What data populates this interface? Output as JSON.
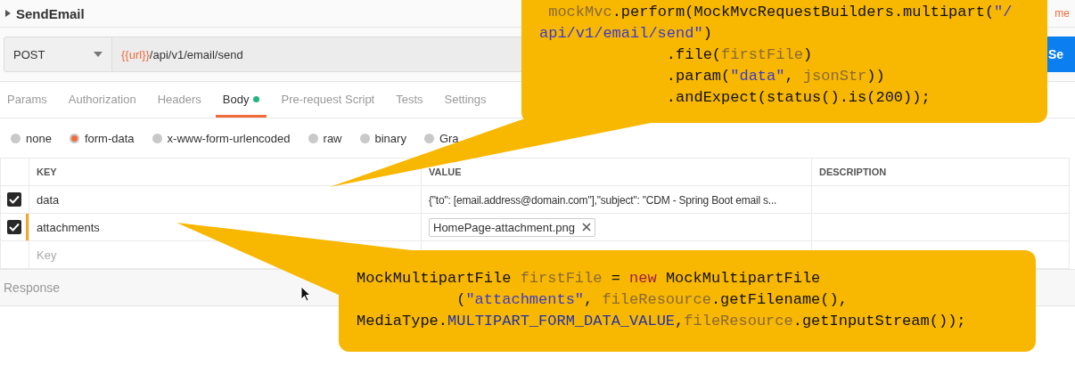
{
  "request": {
    "name": "SendEmail",
    "corner_text": "me",
    "method": "POST",
    "url_variable": "{{url}}",
    "url_path": "/api/v1/email/send",
    "send_label": "Se"
  },
  "tabs": [
    {
      "label": "Params",
      "selected": false,
      "dot": false
    },
    {
      "label": "Authorization",
      "selected": false,
      "dot": false
    },
    {
      "label": "Headers",
      "selected": false,
      "dot": false
    },
    {
      "label": "Body",
      "selected": true,
      "dot": true
    },
    {
      "label": "Pre-request Script",
      "selected": false,
      "dot": false
    },
    {
      "label": "Tests",
      "selected": false,
      "dot": false
    },
    {
      "label": "Settings",
      "selected": false,
      "dot": false
    }
  ],
  "body_types": [
    {
      "label": "none",
      "selected": false
    },
    {
      "label": "form-data",
      "selected": true
    },
    {
      "label": "x-www-form-urlencoded",
      "selected": false
    },
    {
      "label": "raw",
      "selected": false
    },
    {
      "label": "binary",
      "selected": false
    },
    {
      "label": "Gra",
      "selected": false
    }
  ],
  "table": {
    "columns": [
      "KEY",
      "VALUE",
      "DESCRIPTION"
    ],
    "rows": [
      {
        "checked": true,
        "focused": false,
        "key": "data",
        "value": "{\"to\": [email.address@domain.com\"],\"subject\": \"CDM - Spring Boot email s...",
        "kind": "text"
      },
      {
        "checked": true,
        "focused": true,
        "key": "attachments",
        "value": "HomePage-attachment.png",
        "kind": "file"
      }
    ],
    "key_placeholder": "Key"
  },
  "response": {
    "label": "Response"
  },
  "callouts": [
    {
      "lines": [
        [
          {
            "text": " mockMvc",
            "kind": "var"
          },
          {
            "text": ".perform(MockMvcRequestBuilders.multipart(",
            "kind": "plain"
          },
          {
            "text": "\"/",
            "kind": "str"
          }
        ],
        [
          {
            "text": "api/v1/email/send\"",
            "kind": "str"
          },
          {
            "text": ")",
            "kind": "plain"
          }
        ],
        [
          {
            "text": "              .file(",
            "kind": "plain"
          },
          {
            "text": "firstFile",
            "kind": "var"
          },
          {
            "text": ")",
            "kind": "plain"
          }
        ],
        [
          {
            "text": "              .param(",
            "kind": "plain"
          },
          {
            "text": "\"data\"",
            "kind": "str"
          },
          {
            "text": ", ",
            "kind": "plain"
          },
          {
            "text": "jsonStr",
            "kind": "var"
          },
          {
            "text": "))",
            "kind": "plain"
          }
        ],
        [
          {
            "text": "              .andExpect(status().is(200));",
            "kind": "plain"
          }
        ]
      ]
    },
    {
      "lines": [
        [
          {
            "text": "MockMultipartFile ",
            "kind": "plain"
          },
          {
            "text": "firstFile",
            "kind": "var"
          },
          {
            "text": " = ",
            "kind": "plain"
          },
          {
            "text": "new",
            "kind": "kw"
          },
          {
            "text": " MockMultipartFile",
            "kind": "plain"
          }
        ],
        [
          {
            "text": "           (",
            "kind": "plain"
          },
          {
            "text": "\"attachments\"",
            "kind": "str"
          },
          {
            "text": ", ",
            "kind": "plain"
          },
          {
            "text": "fileResource",
            "kind": "var"
          },
          {
            "text": ".getFilename(),",
            "kind": "plain"
          }
        ],
        [
          {
            "text": "MediaType.",
            "kind": "plain"
          },
          {
            "text": "MULTIPART_FORM_DATA_VALUE",
            "kind": "const"
          },
          {
            "text": ",",
            "kind": "plain"
          },
          {
            "text": "fileResource",
            "kind": "var"
          },
          {
            "text": ".getInputStream());",
            "kind": "plain"
          }
        ]
      ]
    }
  ]
}
